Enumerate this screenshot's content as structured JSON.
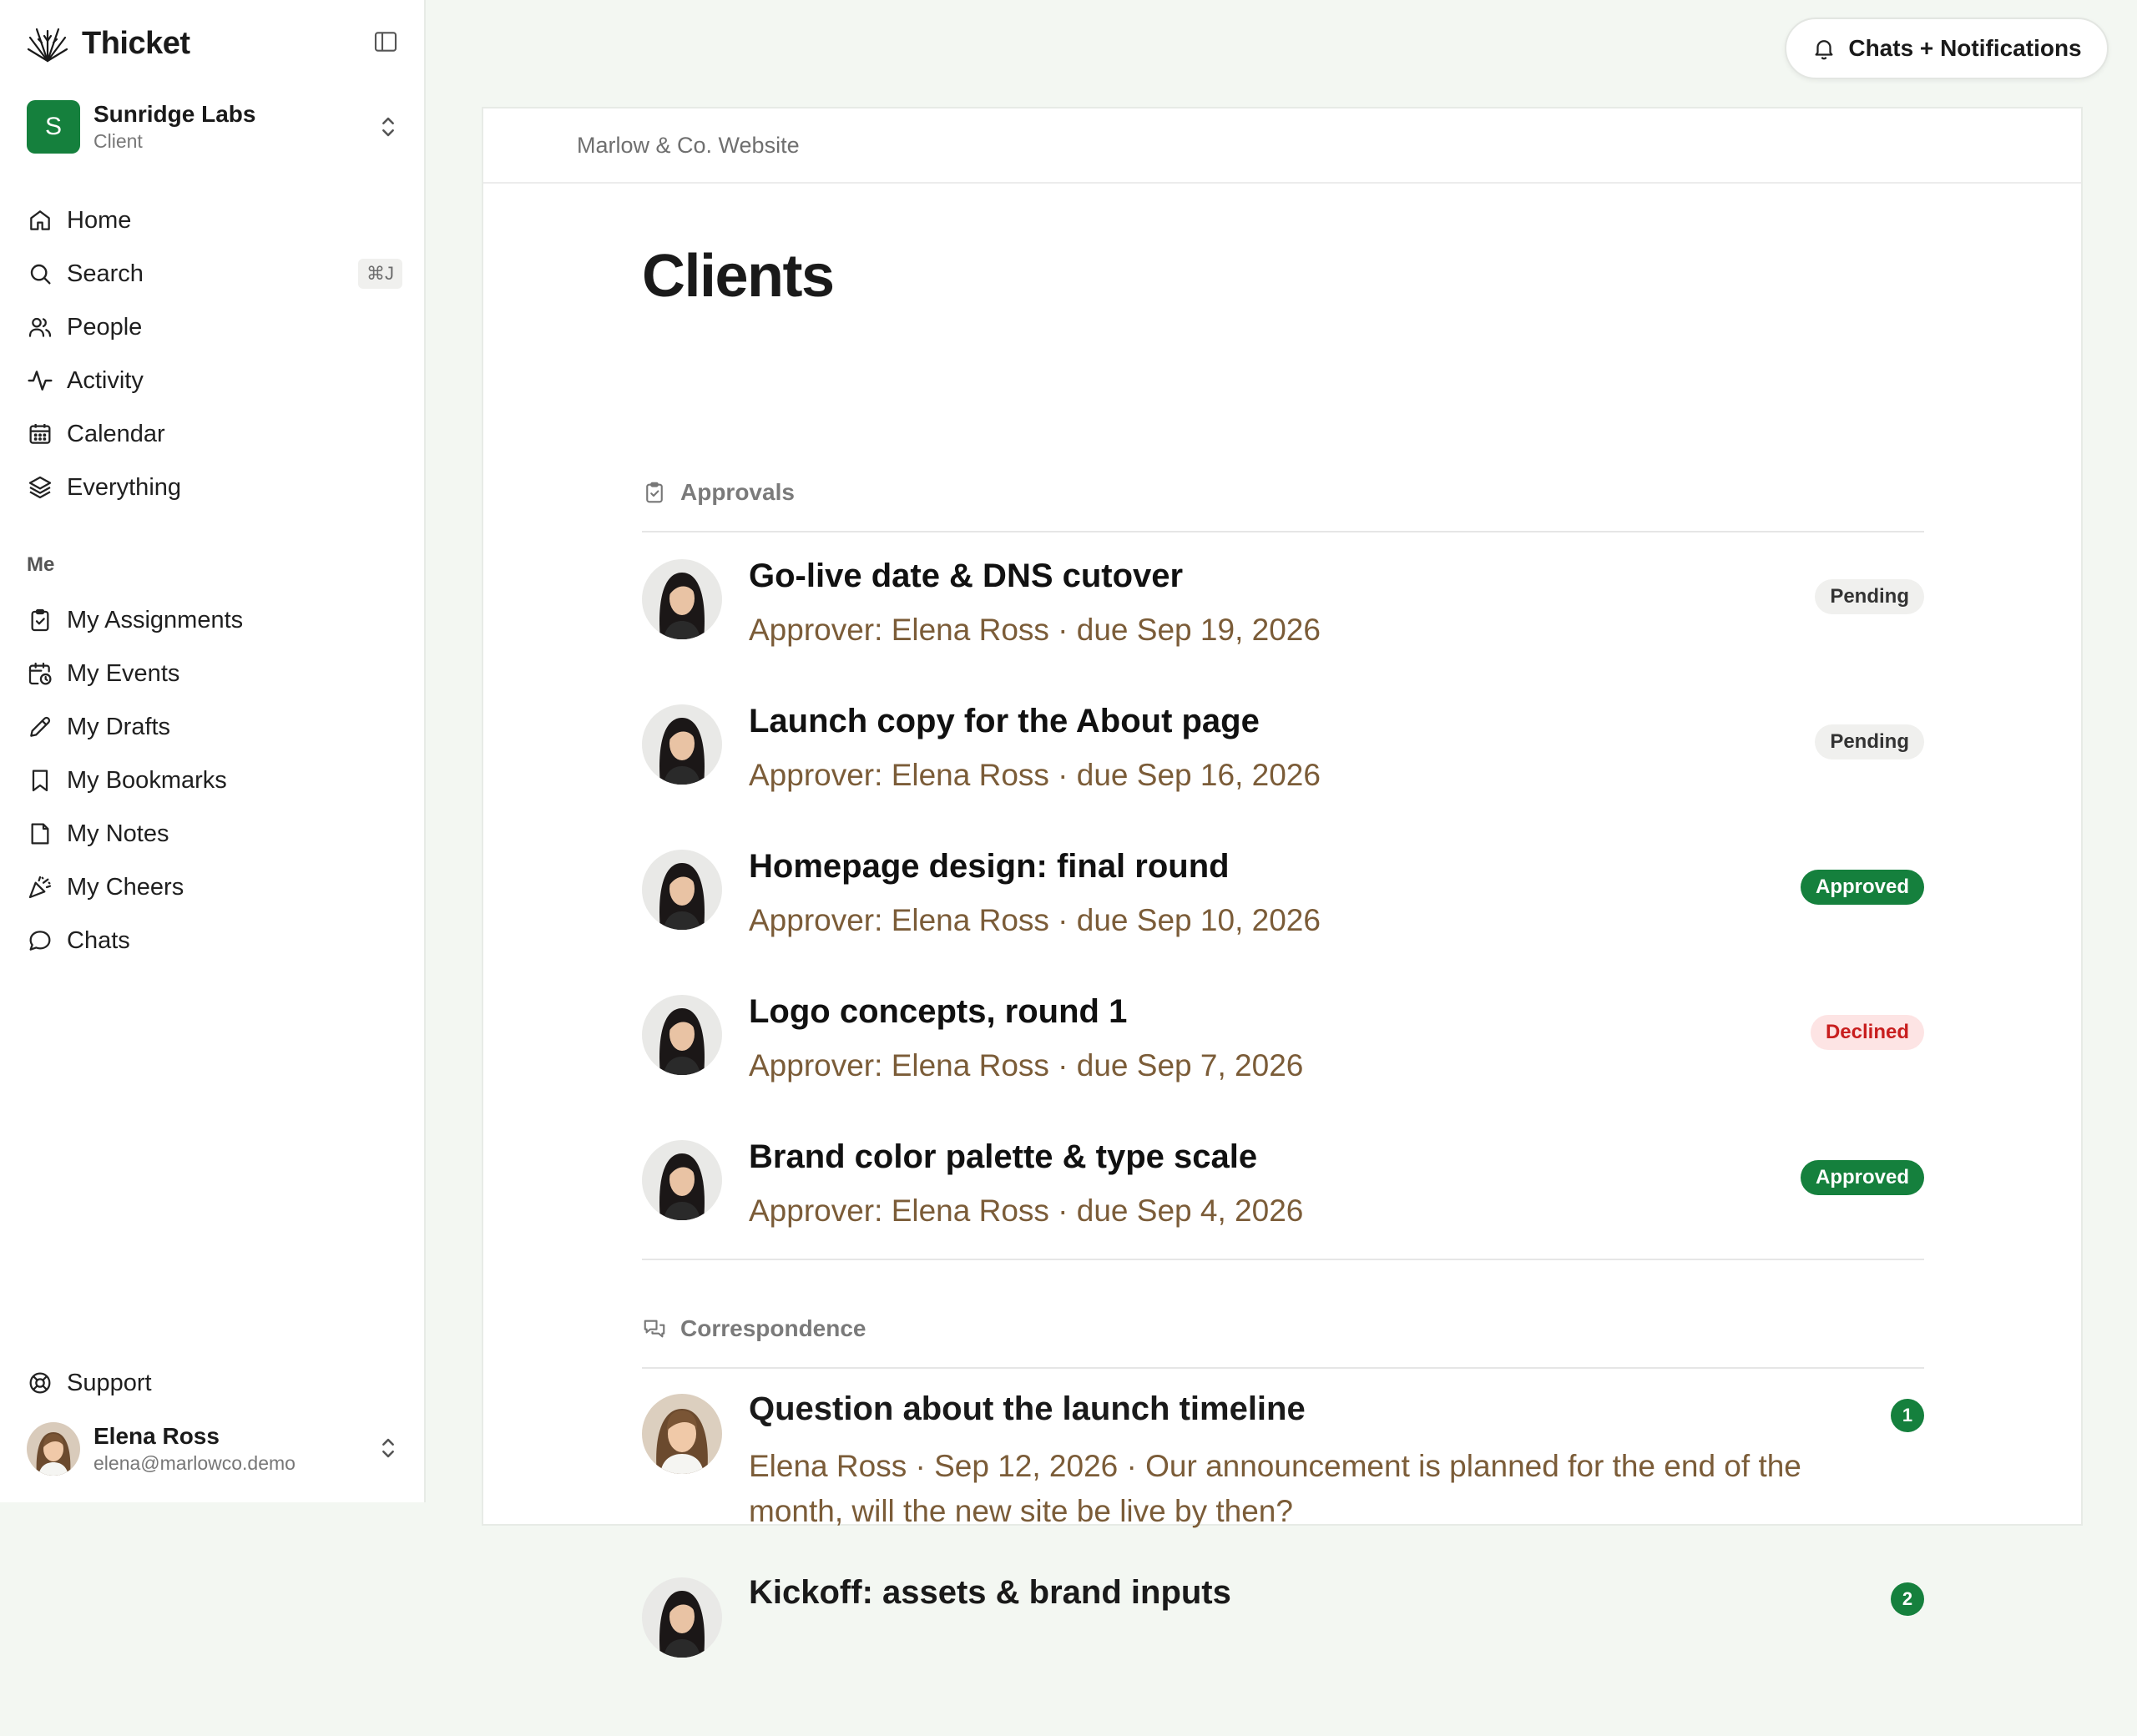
{
  "brand": {
    "name": "Thicket"
  },
  "org": {
    "initial": "S",
    "name": "Sunridge Labs",
    "role": "Client"
  },
  "nav": {
    "home": "Home",
    "search": "Search",
    "search_shortcut": "⌘J",
    "people": "People",
    "activity": "Activity",
    "calendar": "Calendar",
    "everything": "Everything"
  },
  "me": {
    "label": "Me",
    "assignments": "My Assignments",
    "events": "My Events",
    "drafts": "My Drafts",
    "bookmarks": "My Bookmarks",
    "notes": "My Notes",
    "cheers": "My Cheers",
    "chats": "Chats"
  },
  "footer": {
    "support": "Support",
    "user_name": "Elena Ross",
    "user_email": "elena@marlowco.demo"
  },
  "topbar": {
    "notifications_label": "Chats + Notifications"
  },
  "breadcrumb": "Marlow & Co. Website",
  "page_title": "Clients",
  "approvals": {
    "label": "Approvals",
    "items": [
      {
        "title": "Go-live date & DNS cutover",
        "meta": "Approver: Elena Ross · due Sep 19, 2026",
        "status": "Pending"
      },
      {
        "title": "Launch copy for the About page",
        "meta": "Approver: Elena Ross · due Sep 16, 2026",
        "status": "Pending"
      },
      {
        "title": "Homepage design: final round",
        "meta": "Approver: Elena Ross · due Sep 10, 2026",
        "status": "Approved"
      },
      {
        "title": "Logo concepts, round 1",
        "meta": "Approver: Elena Ross · due Sep 7, 2026",
        "status": "Declined"
      },
      {
        "title": "Brand color palette & type scale",
        "meta": "Approver: Elena Ross · due Sep 4, 2026",
        "status": "Approved"
      }
    ]
  },
  "correspondence": {
    "label": "Correspondence",
    "items": [
      {
        "title": "Question about the launch timeline",
        "meta": "Elena Ross · Sep 12, 2026 · Our announcement is planned for the end of the month, will the new site be live by then?",
        "count": "1"
      },
      {
        "title": "Kickoff: assets & brand inputs",
        "count": "2"
      }
    ]
  },
  "colors": {
    "accent": "#15803d",
    "meta_text": "#7b5c38",
    "declined": "#c81e1e"
  }
}
